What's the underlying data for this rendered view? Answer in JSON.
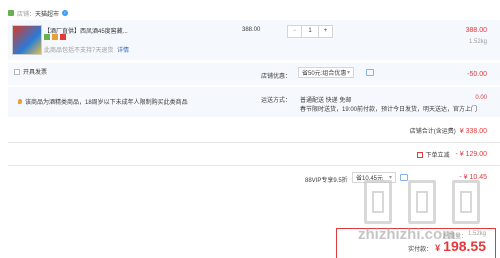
{
  "store": {
    "prefix": "店铺：",
    "name": "天猫超市",
    "badge_color": "#3b9cf5"
  },
  "product": {
    "title": "【酒厂直供】西凤酒45度窖藏...",
    "notice": "此商品包括不支持7天退货",
    "notice_link": "详情",
    "unit_price": "388.00",
    "quantity": "1",
    "minus": "−",
    "plus": "+",
    "total_price": "388.00",
    "weight": "1.52kg"
  },
  "invoice": {
    "label": "开具发票"
  },
  "discount": {
    "label": "店铺优惠：",
    "select_value": "省50元:组合优惠",
    "amount": "-50.00"
  },
  "delivery": {
    "warning": "该商品为酒精类商品，18周岁以下未成年人限制购买此类商品",
    "label": "运送方式：",
    "method": "普通配送 快递 免邮",
    "detail": "春节限时送货，19:00前付款，预计今日发货，明天送达，官方上门",
    "fee": "0.00"
  },
  "store_total": {
    "label": "店铺合计(含运费)",
    "value": "¥ 338.00"
  },
  "cross_store": {
    "label": "下单立减",
    "value": "- ¥ 129.00"
  },
  "vip": {
    "label": "88VIP专享9.5折",
    "select_value": "省10.45元",
    "value": "- ¥ 10.45"
  },
  "summary": {
    "weight_label": "总重量：",
    "weight": "1.52kg",
    "pay_label": "实付款：",
    "currency": "¥",
    "pay_value": "198.55"
  },
  "watermark": {
    "text": "zhizhizhi.com"
  },
  "colors": {
    "accent": "#e4393c",
    "row_bg": "#f5f8fc",
    "link": "#3b6cb8"
  }
}
